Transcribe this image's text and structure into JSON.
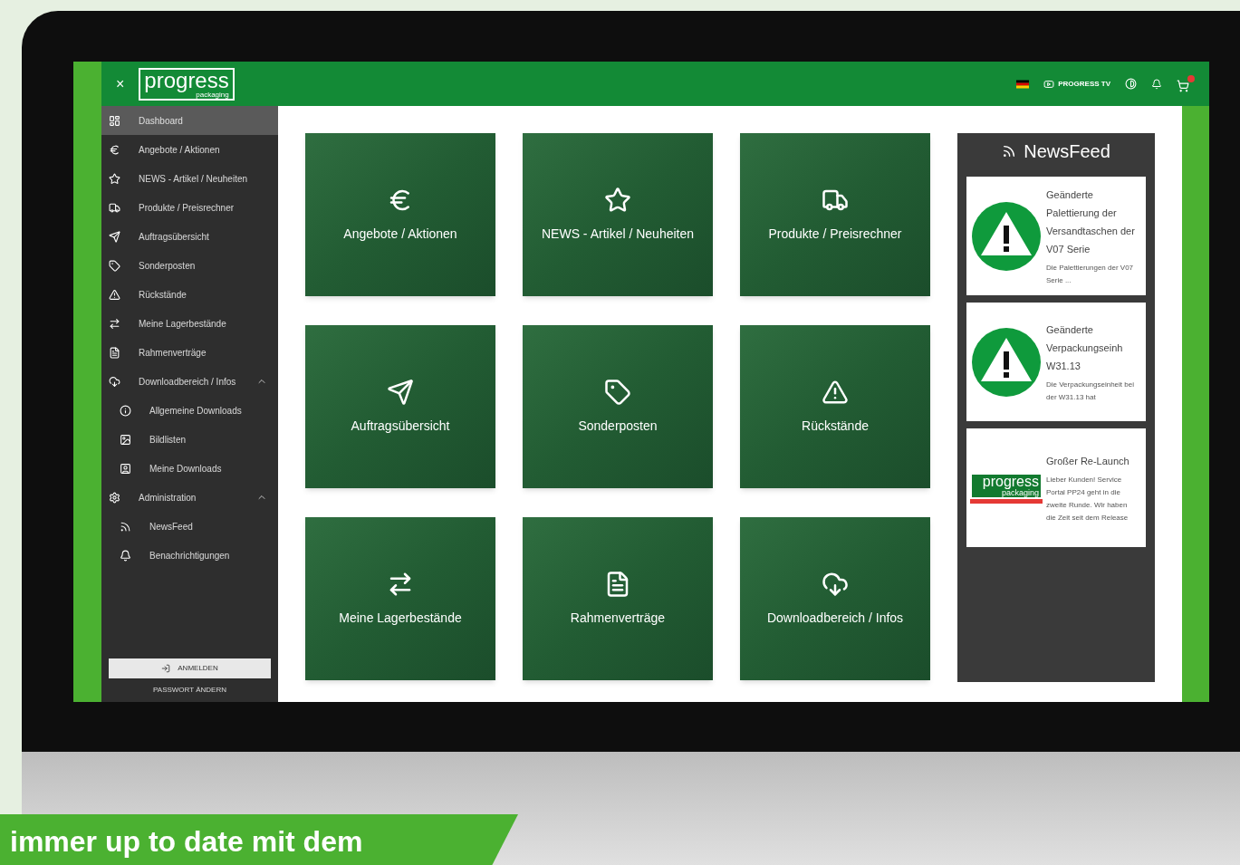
{
  "topbar": {
    "close": "×",
    "logo": "progress",
    "logo_sub": "packaging",
    "tv_label": "PROGRESS TV"
  },
  "sidebar": {
    "items": [
      {
        "label": "Dashboard",
        "selected": true
      },
      {
        "label": "Angebote / Aktionen",
        "selected": false
      },
      {
        "label": "NEWS - Artikel / Neuheiten",
        "selected": false
      },
      {
        "label": "Produkte / Preisrechner",
        "selected": false
      },
      {
        "label": "Auftragsübersicht",
        "selected": false
      },
      {
        "label": "Sonderposten",
        "selected": false
      },
      {
        "label": "Rückstände",
        "selected": false
      },
      {
        "label": "Meine Lagerbestände",
        "selected": false
      },
      {
        "label": "Rahmenverträge",
        "selected": false
      },
      {
        "label": "Downloadbereich / Infos",
        "selected": false,
        "expanded": true,
        "children": [
          {
            "label": "Allgemeine Downloads",
            "selected": false
          },
          {
            "label": "Bildlisten",
            "selected": false
          },
          {
            "label": "Meine Downloads",
            "selected": false
          }
        ]
      },
      {
        "label": "Administration",
        "selected": false,
        "expanded": true,
        "children": [
          {
            "label": "NewsFeed",
            "selected": false
          },
          {
            "label": "Benachrichtigungen",
            "selected": false
          }
        ]
      }
    ],
    "login_button": "ANMELDEN",
    "password_link": "PASSWORT ÄNDERN"
  },
  "tiles": [
    "Angebote / Aktionen",
    "NEWS - Artikel / Neuheiten",
    "Produkte / Preisrechner",
    "Auftragsübersicht",
    "Sonderposten",
    "Rückstände",
    "Meine Lagerbestände",
    "Rahmenverträge",
    "Downloadbereich / Infos"
  ],
  "newsfeed": {
    "title": "NewsFeed",
    "items": [
      {
        "kind": "warning",
        "title": "Geänderte Palettierung der Versandtaschen der V07 Serie",
        "body": "Die Palettierungen der V07 Serie ..."
      },
      {
        "kind": "warning",
        "title": "Geänderte Verpackungseinh W31.13",
        "body": "Die Verpackungseinheit bei der W31.13 hat"
      },
      {
        "kind": "logo",
        "logo": "progress",
        "logo_sub": "packaging",
        "title": "Großer Re-Launch",
        "body": "Lieber Kunden! Service Portal PP24 geht in die zweite Runde. Wir haben die Zeit seit dem Release"
      }
    ]
  },
  "banner": "immer up to date mit dem"
}
